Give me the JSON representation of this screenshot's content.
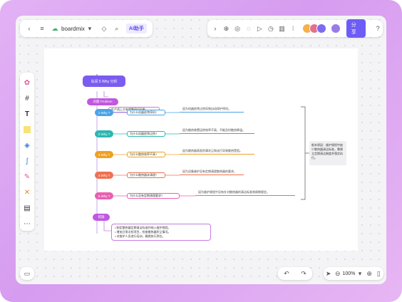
{
  "toolbar": {
    "app_name": "boardmix",
    "ai_label": "AI助手",
    "share_label": "分享"
  },
  "zoom": {
    "level": "100%"
  },
  "mindmap": {
    "root": "车间 5 Why 分析",
    "problem_node": "问题 Problem",
    "problem_text": "生产线上方有频繁停机现象",
    "whys": [
      {
        "label": "1 Why ?",
        "question": "为什么机器经常停机?",
        "answer": "因为机器经常过热导致自动保护停机。",
        "color": "#4aa3e8"
      },
      {
        "label": "2 Why ?",
        "question": "为什么机器经常过热?",
        "answer": "因为散热装置运转效率不高，不能及时散热降温。",
        "color": "#2db7b0"
      },
      {
        "label": "3 Why ?",
        "question": "为什么散热效率不高?",
        "answer": "因为散热器表面积满灰尘和油污导致散热受阻。",
        "color": "#f0a020"
      },
      {
        "label": "4 Why ?",
        "question": "为什么散热器未清理?",
        "answer": "因为设备维护没有定期清理散热器的要求。",
        "color": "#f07050"
      },
      {
        "label": "5 Why ?",
        "question": "为什么没有定期清理要求?",
        "answer": "因为维护规程中没有针对散热器的清洁标准和周期规定。",
        "color": "#e860b0"
      }
    ],
    "summary_text": "根本原因：维护规程中缺少散热器清洁标准，需建立定期清洁制度并落实执行。",
    "solution_node": "措施",
    "solutions": [
      "制定散热器定期清洁标准并纳入维护规程。",
      "增加日常点检项目，检查散热器积尘情况。",
      "对维护人员进行培训，确保执行到位。"
    ]
  }
}
